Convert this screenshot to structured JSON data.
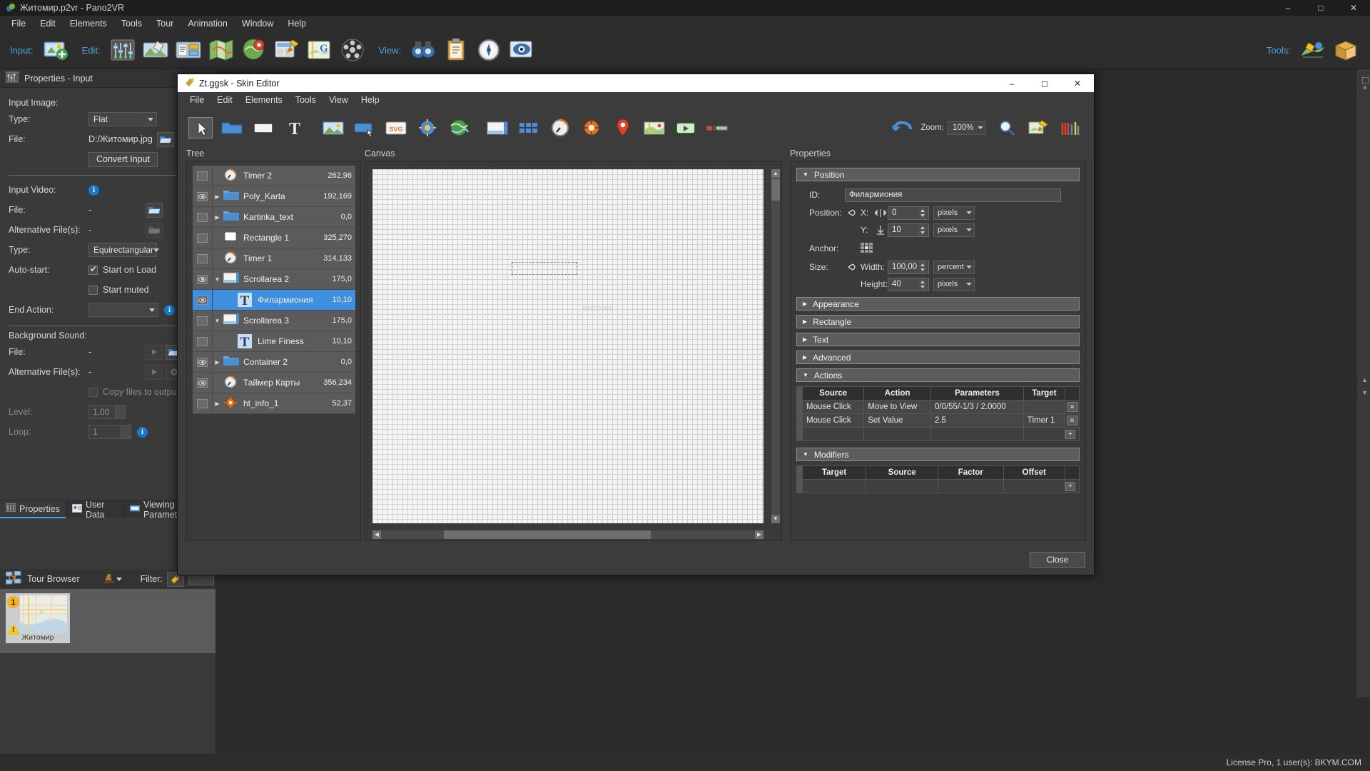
{
  "app": {
    "title": "Житомир.p2vr - Pano2VR",
    "menu": [
      "File",
      "Edit",
      "Elements",
      "Tools",
      "Tour",
      "Animation",
      "Window",
      "Help"
    ],
    "window_buttons": [
      "minimize",
      "maximize",
      "close"
    ],
    "toolbar": {
      "input_label": "Input:",
      "edit_label": "Edit:",
      "view_label": "View:",
      "tools_label": "Tools:",
      "icons": [
        "add-input-icon",
        "properties-sliders-icon",
        "patch-tool-icon",
        "hotspot-editor-icon",
        "map-editor-icon",
        "pin-marker-icon",
        "skin-editor-icon",
        "google-maps-icon",
        "film-strip-icon",
        "binoculars-icon",
        "clipboard-icon",
        "compass-icon",
        "preview-eye-icon",
        "output-tree-icon",
        "package-box-icon"
      ]
    },
    "statusbar": "License Pro, 1 user(s): BKYM.COM"
  },
  "left_dock": {
    "header": "Properties - Input",
    "header_icon": "sliders-icon",
    "input_image_label": "Input Image:",
    "type_label": "Type:",
    "type_value": "Flat",
    "file_label": "File:",
    "file_value": "D:/Житомир.jpg",
    "browse_icon": "folder-open-icon",
    "convert_button": "Convert Input",
    "input_video_label": "Input Video:",
    "video_file_label": "File:",
    "video_file_value": "-",
    "alt_files_label": "Alternative File(s):",
    "alt_files_value": "-",
    "video_type_label": "Type:",
    "video_type_value": "Equirectangular",
    "autostart_label": "Auto-start:",
    "start_on_load": "Start on Load",
    "start_on_load_checked": true,
    "start_muted": "Start muted",
    "start_muted_checked": false,
    "end_action_label": "End Action:",
    "end_action_value": "",
    "bgsound_label": "Background Sound:",
    "bg_file_label": "File:",
    "bg_file_value": "-",
    "bg_alt_label": "Alternative File(s):",
    "bg_alt_value": "-",
    "copy_files_label": "Copy files to output",
    "level_label": "Level:",
    "level_value": "1,00",
    "loop_label": "Loop:",
    "loop_value": "1",
    "tabs": [
      {
        "label": "Properties",
        "icon": "sliders-icon",
        "active": true
      },
      {
        "label": "User Data",
        "icon": "user-card-icon",
        "active": false
      },
      {
        "label": "Viewing Parameters",
        "icon": "viewing-icon",
        "active": false
      }
    ],
    "tour_browser": {
      "title": "Tour Browser",
      "title_icon": "tour-nodes-icon",
      "stamp_icon": "stamp-icon",
      "filter_label": "Filter:",
      "filter_icon": "filter-tag-icon",
      "nodes": [
        {
          "caption": "Житомир",
          "index": "1",
          "has_warning": true
        }
      ]
    }
  },
  "skin_editor": {
    "title": "Zt.ggsk - Skin Editor",
    "title_icon": "skin-editor-icon",
    "window_buttons": [
      "minimize",
      "maximize",
      "close"
    ],
    "menu": [
      "File",
      "Edit",
      "Elements",
      "Tools",
      "View",
      "Help"
    ],
    "toolbar": {
      "zoom_label": "Zoom:",
      "zoom_value": "100%",
      "undo_icon": "undo-arrow-icon",
      "icons": [
        "cursor-select-icon",
        "container-icon",
        "rectangle-icon",
        "text-icon",
        "image-icon",
        "button-icon",
        "svg-icon",
        "hotspot-icon",
        "world-map-icon",
        "scrollarea-icon",
        "grid-thumbnails-icon",
        "timer-icon",
        "gyro-icon",
        "map-pin-icon",
        "floorplan-icon",
        "video-icon",
        "slider-icon",
        "search-icon",
        "export-skin-icon",
        "tools-icon"
      ]
    },
    "columns": {
      "tree_label": "Tree",
      "canvas_label": "Canvas",
      "properties_label": "Properties"
    },
    "tree": [
      {
        "name": "Timer 2",
        "coord": "262,96",
        "icon": "timer-icon",
        "visible": false,
        "expand": "none",
        "indent": 0,
        "selected": false
      },
      {
        "name": "Poly_Karta",
        "coord": "192,169",
        "icon": "container-icon",
        "visible": true,
        "expand": "collapsed",
        "indent": 0,
        "selected": false
      },
      {
        "name": "Kartinka_text",
        "coord": "0,0",
        "icon": "container-icon",
        "visible": false,
        "expand": "collapsed",
        "indent": 0,
        "selected": false
      },
      {
        "name": "Rectangle 1",
        "coord": "325,270",
        "icon": "rectangle-icon",
        "visible": false,
        "expand": "none",
        "indent": 0,
        "selected": false
      },
      {
        "name": "Timer 1",
        "coord": "314,133",
        "icon": "timer-icon",
        "visible": false,
        "expand": "none",
        "indent": 0,
        "selected": false
      },
      {
        "name": "Scrollarea 2",
        "coord": "175,0",
        "icon": "scrollarea-icon",
        "visible": true,
        "expand": "expanded",
        "indent": 0,
        "selected": false
      },
      {
        "name": "Филармиония",
        "coord": "10,10",
        "icon": "text-icon",
        "visible": true,
        "expand": "none",
        "indent": 1,
        "selected": true
      },
      {
        "name": "Scrollarea 3",
        "coord": "175,0",
        "icon": "scrollarea-icon",
        "visible": false,
        "expand": "expanded",
        "indent": 0,
        "selected": false
      },
      {
        "name": "Lime Finess",
        "coord": "10,10",
        "icon": "text-icon",
        "visible": false,
        "expand": "none",
        "indent": 1,
        "selected": false
      },
      {
        "name": "Container 2",
        "coord": "0,0",
        "icon": "container-icon",
        "visible": true,
        "expand": "collapsed",
        "indent": 0,
        "selected": false
      },
      {
        "name": "Таймер Карты",
        "coord": "356,234",
        "icon": "timer-icon",
        "visible": true,
        "expand": "none",
        "indent": 0,
        "selected": false
      },
      {
        "name": "ht_info_1",
        "coord": "52,37",
        "icon": "hotspot-icon",
        "visible": false,
        "expand": "collapsed",
        "indent": 0,
        "selected": false
      }
    ],
    "canvas": {
      "ghost_label": "00/0/0,000"
    },
    "properties": {
      "sections": [
        {
          "label": "Position",
          "expanded": true
        },
        {
          "label": "Appearance",
          "expanded": false
        },
        {
          "label": "Rectangle",
          "expanded": false
        },
        {
          "label": "Text",
          "expanded": false
        },
        {
          "label": "Advanced",
          "expanded": false
        },
        {
          "label": "Actions",
          "expanded": true
        },
        {
          "label": "Modifiers",
          "expanded": true
        }
      ],
      "id_label": "ID:",
      "id_value": "Филармиония",
      "position_label": "Position:",
      "x_label": "X:",
      "x_value": "0",
      "x_unit": "pixels",
      "y_label": "Y:",
      "y_value": "10",
      "y_unit": "pixels",
      "anchor_label": "Anchor:",
      "size_label": "Size:",
      "width_label": "Width:",
      "width_value": "100,00",
      "width_unit": "percent",
      "height_label": "Height:",
      "height_value": "40",
      "height_unit": "pixels",
      "actions": {
        "headers": [
          "Source",
          "Action",
          "Parameters",
          "Target"
        ],
        "rows": [
          {
            "source": "Mouse Click",
            "action": "Move to View",
            "parameters": "0/0/55/-1/3 / 2.0000",
            "target": ""
          },
          {
            "source": "Mouse Click",
            "action": "Set Value",
            "parameters": "2.5",
            "target": "Timer 1"
          }
        ],
        "add_label": "+"
      },
      "modifiers": {
        "headers": [
          "Target",
          "Source",
          "Factor",
          "Offset"
        ],
        "rows": [],
        "add_label": "+"
      }
    },
    "close_button": "Close"
  }
}
